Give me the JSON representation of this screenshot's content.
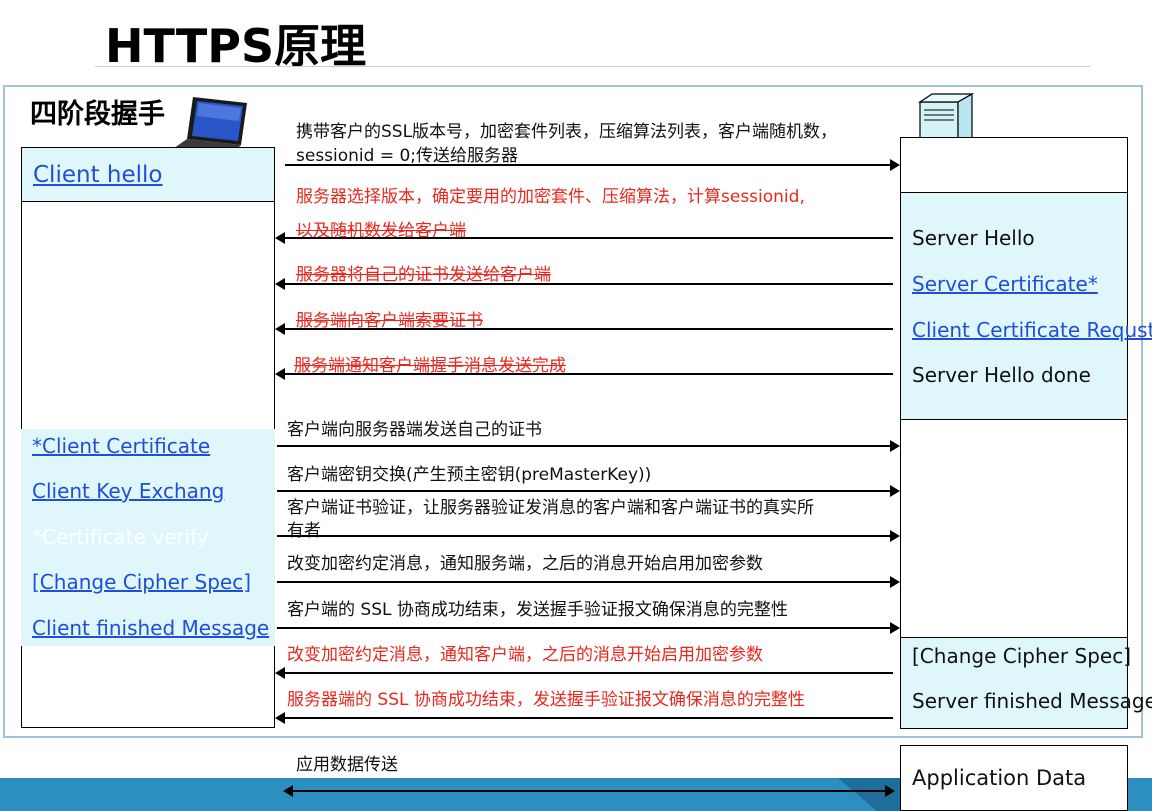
{
  "title": "HTTPS原理",
  "subtitle": "四阶段握手",
  "client": {
    "hello": "Client hello",
    "steps": [
      "*Client Certificate",
      "Client Key Exchang",
      "*Certificate verify",
      "[Change Cipher Spec]",
      "Client finished Message"
    ]
  },
  "server": {
    "hello_steps": [
      "Server Hello",
      "Server Certificate*",
      "Client Certificate Requst*",
      "Server Hello done"
    ],
    "finish_steps": [
      "[Change Cipher Spec]",
      "Server finished Message"
    ],
    "app_data": "Application Data"
  },
  "messages": {
    "m1_line1": "携带客户的SSL版本号，加密套件列表，压缩算法列表，客户端随机数，",
    "m1_line2": "sessionid = 0;传送给服务器",
    "m2_line1": "服务器选择版本，确定要用的加密套件、压缩算法，计算sessionid,",
    "m2_line2": "以及随机数发给客户端",
    "m3": "服务器将自己的证书发送给客户端",
    "m4": "服务端向客户端索要证书",
    "m5": "服务端通知客户端握手消息发送完成",
    "m6": "客户端向服务器端发送自己的证书",
    "m7": "客户端密钥交换(产生预主密钥(preMasterKey))",
    "m8_line1": "客户端证书验证，让服务器验证发消息的客户端和客户端证书的真实所",
    "m8_line2": "有者",
    "m9": "改变加密约定消息，通知服务端，之后的消息开始启用加密参数",
    "m10": "客户端的 SSL 协商成功结束，发送握手验证报文确保消息的完整性",
    "m11": "改变加密约定消息，通知客户端，之后的消息开始启用加密参数",
    "m12": "服务器端的 SSL 协商成功结束，发送握手验证报文确保消息的完整性",
    "m13": "应用数据传送"
  },
  "icons": [
    "laptop-icon",
    "server-icon"
  ],
  "colors": {
    "accent_blue": "#1f4fd8",
    "red_text": "#e8281e",
    "cyan_fill": "#dff7fb",
    "frame_border": "#9cc5d8",
    "bottom_bar": "#2d8ec0"
  }
}
